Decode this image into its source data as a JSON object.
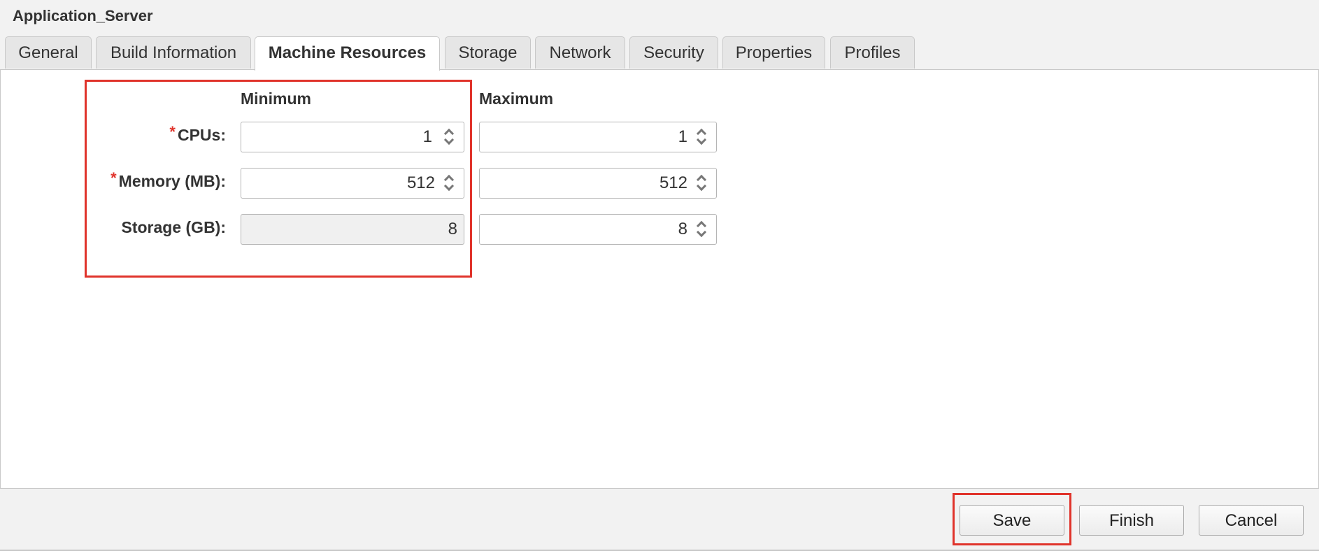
{
  "window": {
    "title": "Application_Server"
  },
  "tabs": [
    {
      "label": "General",
      "active": false
    },
    {
      "label": "Build Information",
      "active": false
    },
    {
      "label": "Machine Resources",
      "active": true
    },
    {
      "label": "Storage",
      "active": false
    },
    {
      "label": "Network",
      "active": false
    },
    {
      "label": "Security",
      "active": false
    },
    {
      "label": "Properties",
      "active": false
    },
    {
      "label": "Profiles",
      "active": false
    }
  ],
  "resources": {
    "minimum_header": "Minimum",
    "maximum_header": "Maximum",
    "rows": [
      {
        "label": "CPUs:",
        "required": true,
        "required_mark": "*",
        "minimum": "1",
        "maximum": "1",
        "minimum_editable": true
      },
      {
        "label": "Memory (MB):",
        "required": true,
        "required_mark": "*",
        "minimum": "512",
        "maximum": "512",
        "minimum_editable": true
      },
      {
        "label": "Storage (GB):",
        "required": false,
        "minimum": "8",
        "maximum": "8",
        "minimum_editable": false
      }
    ]
  },
  "footer": {
    "save_label": "Save",
    "finish_label": "Finish",
    "cancel_label": "Cancel"
  },
  "colors": {
    "highlight": "#e0332b",
    "required_mark": "#e0332b"
  }
}
